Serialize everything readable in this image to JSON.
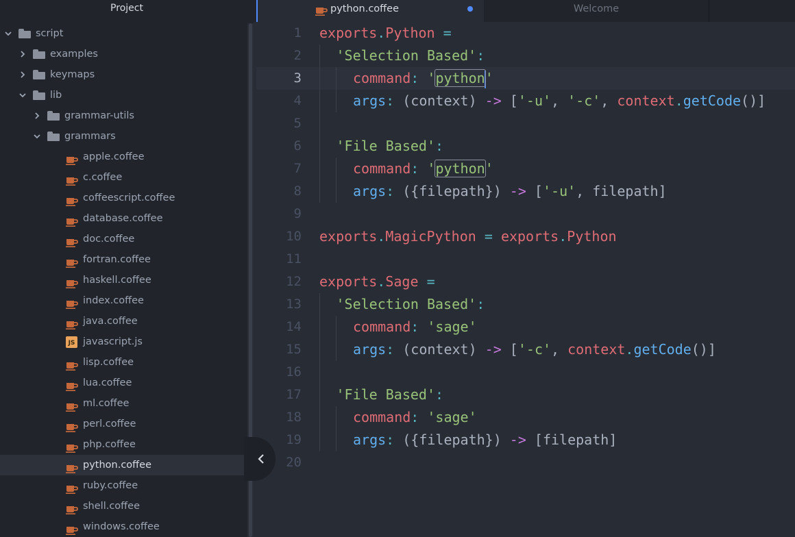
{
  "sidebar": {
    "title": "Project",
    "tree": [
      {
        "label": "script",
        "type": "folder",
        "expanded": true,
        "depth": 0
      },
      {
        "label": "examples",
        "type": "folder",
        "expanded": false,
        "depth": 1
      },
      {
        "label": "keymaps",
        "type": "folder",
        "expanded": false,
        "depth": 1
      },
      {
        "label": "lib",
        "type": "folder",
        "expanded": true,
        "depth": 1
      },
      {
        "label": "grammar-utils",
        "type": "folder",
        "expanded": false,
        "depth": 2
      },
      {
        "label": "grammars",
        "type": "folder",
        "expanded": true,
        "depth": 2
      },
      {
        "label": "apple.coffee",
        "type": "coffee",
        "depth": 3
      },
      {
        "label": "c.coffee",
        "type": "coffee",
        "depth": 3
      },
      {
        "label": "coffeescript.coffee",
        "type": "coffee",
        "depth": 3
      },
      {
        "label": "database.coffee",
        "type": "coffee",
        "depth": 3
      },
      {
        "label": "doc.coffee",
        "type": "coffee",
        "depth": 3
      },
      {
        "label": "fortran.coffee",
        "type": "coffee",
        "depth": 3
      },
      {
        "label": "haskell.coffee",
        "type": "coffee",
        "depth": 3
      },
      {
        "label": "index.coffee",
        "type": "coffee",
        "depth": 3
      },
      {
        "label": "java.coffee",
        "type": "coffee",
        "depth": 3
      },
      {
        "label": "javascript.js",
        "type": "js",
        "depth": 3
      },
      {
        "label": "lisp.coffee",
        "type": "coffee",
        "depth": 3
      },
      {
        "label": "lua.coffee",
        "type": "coffee",
        "depth": 3
      },
      {
        "label": "ml.coffee",
        "type": "coffee",
        "depth": 3
      },
      {
        "label": "perl.coffee",
        "type": "coffee",
        "depth": 3
      },
      {
        "label": "php.coffee",
        "type": "coffee",
        "depth": 3
      },
      {
        "label": "python.coffee",
        "type": "coffee",
        "depth": 3,
        "selected": true
      },
      {
        "label": "ruby.coffee",
        "type": "coffee",
        "depth": 3
      },
      {
        "label": "shell.coffee",
        "type": "coffee",
        "depth": 3
      },
      {
        "label": "windows.coffee",
        "type": "coffee",
        "depth": 3
      }
    ],
    "js_icon_text": "JS"
  },
  "tabs": [
    {
      "label": "python.coffee",
      "active": true,
      "modified": true
    },
    {
      "label": "Welcome",
      "active": false
    }
  ],
  "editor": {
    "cursor_line": 3,
    "lines": [
      {
        "n": "1",
        "indent": 0,
        "tokens": [
          [
            "e",
            "exports"
          ],
          [
            "o",
            "."
          ],
          [
            "e",
            "Python"
          ],
          [
            "t",
            " "
          ],
          [
            "o",
            "="
          ]
        ]
      },
      {
        "n": "2",
        "indent": 1,
        "tokens": [
          [
            "s",
            "'Selection Based'"
          ],
          [
            "o",
            ":"
          ]
        ]
      },
      {
        "n": "3",
        "indent": 2,
        "tokens": [
          [
            "e",
            "command"
          ],
          [
            "o",
            ":"
          ],
          [
            "t",
            " "
          ],
          [
            "s",
            "'"
          ],
          [
            "shl",
            "python"
          ],
          [
            "caret",
            ""
          ],
          [
            "s",
            "'"
          ]
        ]
      },
      {
        "n": "4",
        "indent": 2,
        "tokens": [
          [
            "b",
            "args"
          ],
          [
            "o",
            ":"
          ],
          [
            "t",
            " (context) "
          ],
          [
            "p",
            "->"
          ],
          [
            "t",
            " ["
          ],
          [
            "s",
            "'-u'"
          ],
          [
            "t",
            ", "
          ],
          [
            "s",
            "'-c'"
          ],
          [
            "t",
            ", "
          ],
          [
            "e",
            "context"
          ],
          [
            "o",
            "."
          ],
          [
            "b",
            "getCode"
          ],
          [
            "t",
            "()]"
          ]
        ]
      },
      {
        "n": "5",
        "indent": 0,
        "tokens": []
      },
      {
        "n": "6",
        "indent": 1,
        "tokens": [
          [
            "s",
            "'File Based'"
          ],
          [
            "o",
            ":"
          ]
        ]
      },
      {
        "n": "7",
        "indent": 2,
        "tokens": [
          [
            "e",
            "command"
          ],
          [
            "o",
            ":"
          ],
          [
            "t",
            " "
          ],
          [
            "s",
            "'"
          ],
          [
            "shl",
            "python"
          ],
          [
            "s",
            "'"
          ]
        ]
      },
      {
        "n": "8",
        "indent": 2,
        "tokens": [
          [
            "b",
            "args"
          ],
          [
            "o",
            ":"
          ],
          [
            "t",
            " ({filepath}) "
          ],
          [
            "p",
            "->"
          ],
          [
            "t",
            " ["
          ],
          [
            "s",
            "'-u'"
          ],
          [
            "t",
            ", filepath]"
          ]
        ]
      },
      {
        "n": "9",
        "indent": 0,
        "tokens": []
      },
      {
        "n": "10",
        "indent": 0,
        "tokens": [
          [
            "e",
            "exports"
          ],
          [
            "o",
            "."
          ],
          [
            "e",
            "MagicPython"
          ],
          [
            "t",
            " "
          ],
          [
            "o",
            "="
          ],
          [
            "t",
            " "
          ],
          [
            "e",
            "exports"
          ],
          [
            "o",
            "."
          ],
          [
            "e",
            "Python"
          ]
        ]
      },
      {
        "n": "11",
        "indent": 0,
        "tokens": []
      },
      {
        "n": "12",
        "indent": 0,
        "tokens": [
          [
            "e",
            "exports"
          ],
          [
            "o",
            "."
          ],
          [
            "e",
            "Sage"
          ],
          [
            "t",
            " "
          ],
          [
            "o",
            "="
          ]
        ]
      },
      {
        "n": "13",
        "indent": 1,
        "tokens": [
          [
            "s",
            "'Selection Based'"
          ],
          [
            "o",
            ":"
          ]
        ]
      },
      {
        "n": "14",
        "indent": 2,
        "tokens": [
          [
            "e",
            "command"
          ],
          [
            "o",
            ":"
          ],
          [
            "t",
            " "
          ],
          [
            "s",
            "'sage'"
          ]
        ]
      },
      {
        "n": "15",
        "indent": 2,
        "tokens": [
          [
            "b",
            "args"
          ],
          [
            "o",
            ":"
          ],
          [
            "t",
            " (context) "
          ],
          [
            "p",
            "->"
          ],
          [
            "t",
            " ["
          ],
          [
            "s",
            "'-c'"
          ],
          [
            "t",
            ", "
          ],
          [
            "e",
            "context"
          ],
          [
            "o",
            "."
          ],
          [
            "b",
            "getCode"
          ],
          [
            "t",
            "()]"
          ]
        ]
      },
      {
        "n": "16",
        "indent": 0,
        "tokens": []
      },
      {
        "n": "17",
        "indent": 1,
        "tokens": [
          [
            "s",
            "'File Based'"
          ],
          [
            "o",
            ":"
          ]
        ]
      },
      {
        "n": "18",
        "indent": 2,
        "tokens": [
          [
            "e",
            "command"
          ],
          [
            "o",
            ":"
          ],
          [
            "t",
            " "
          ],
          [
            "s",
            "'sage'"
          ]
        ]
      },
      {
        "n": "19",
        "indent": 2,
        "tokens": [
          [
            "b",
            "args"
          ],
          [
            "o",
            ":"
          ],
          [
            "t",
            " ({filepath}) "
          ],
          [
            "p",
            "->"
          ],
          [
            "t",
            " [filepath]"
          ]
        ]
      },
      {
        "n": "20",
        "indent": 0,
        "tokens": []
      }
    ]
  },
  "colors": {
    "accent": "#528bff",
    "sidebar_bg": "#21252b",
    "editor_bg": "#282c34",
    "file_icon": "#c7683b"
  }
}
